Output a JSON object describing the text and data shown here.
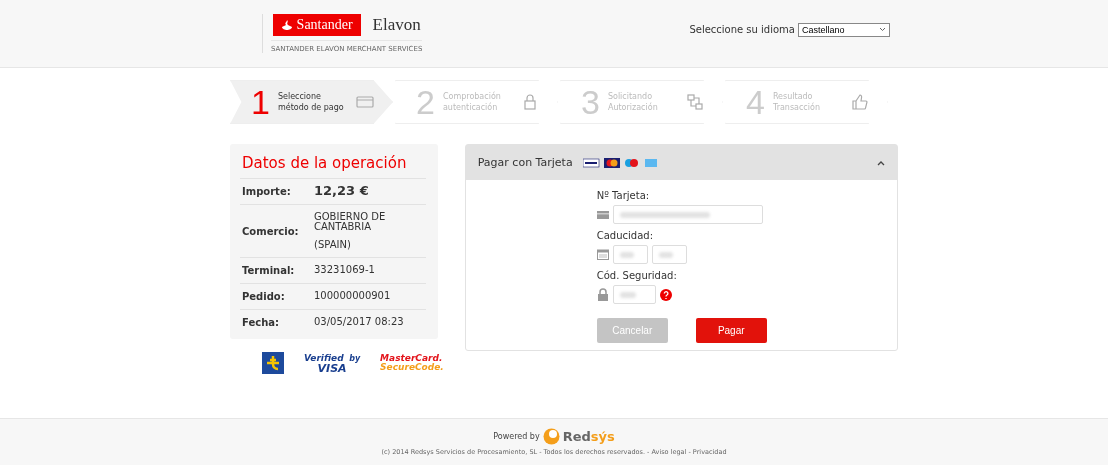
{
  "header": {
    "logo_primary": "Santander",
    "logo_secondary": "Elavon",
    "logo_caption": "SANTANDER ELAVON MERCHANT SERVICES",
    "language_label": "Seleccione su idioma",
    "language_value": "Castellano"
  },
  "steps": [
    {
      "number": "1",
      "line1": "Seleccione",
      "line2": "método de pago",
      "selected": true
    },
    {
      "number": "2",
      "line1": "Comprobación",
      "line2": "autenticación",
      "selected": false
    },
    {
      "number": "3",
      "line1": "Solicitando",
      "line2": "Autorización",
      "selected": false
    },
    {
      "number": "4",
      "line1": "Resultado",
      "line2": "Transacción",
      "selected": false
    }
  ],
  "operation": {
    "title": "Datos de la operación",
    "rows": [
      {
        "label": "Importe:",
        "value": "12,23 €",
        "kind": "amount"
      },
      {
        "label": "Comercio:",
        "value": "GOBIERNO DE CANTABRIA",
        "extra": "(SPAIN)",
        "kind": "text"
      },
      {
        "label": "Terminal:",
        "value": "33231069-1",
        "kind": "text"
      },
      {
        "label": "Pedido:",
        "value": "100000000901",
        "kind": "text"
      },
      {
        "label": "Fecha:",
        "value": "03/05/2017  08:23",
        "kind": "text"
      }
    ]
  },
  "security_logos": {
    "verified_top": "Verified",
    "verified_by": "by",
    "verified_bottom": "VISA",
    "mc_top": "MasterCard.",
    "mc_bottom": "SecureCode."
  },
  "payment": {
    "title": "Pagar con Tarjeta",
    "expanded": true,
    "card_label": "Nº Tarjeta:",
    "expiry_label": "Caducidad:",
    "cvv_label": "Cód. Seguridad:",
    "cancel": "Cancelar",
    "pay": "Pagar",
    "cancel_disabled": true
  },
  "footer": {
    "powered_by": "Powered by",
    "brand": "Red",
    "brand_accent": "sýs",
    "copyright": "(c) 2014 Redsys Servicios de Procesamiento, SL - Todos los derechos reservados. - ",
    "legal": "Aviso legal",
    "separator": " - ",
    "privacy": "Privacidad"
  }
}
